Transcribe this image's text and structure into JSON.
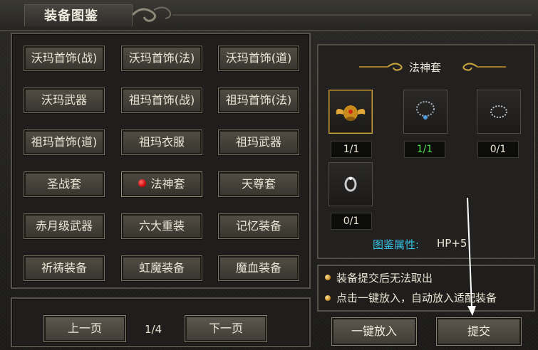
{
  "window": {
    "title": "装备图鉴"
  },
  "categories": [
    [
      "沃玛首饰(战)",
      "沃玛首饰(法)",
      "沃玛首饰(道)"
    ],
    [
      "沃玛武器",
      "祖玛首饰(战)",
      "祖玛首饰(法)"
    ],
    [
      "祖玛首饰(道)",
      "祖玛衣服",
      "祖玛武器"
    ],
    [
      "圣战套",
      "法神套",
      "天尊套"
    ],
    [
      "赤月级武器",
      "六大重装",
      "记忆装备"
    ],
    [
      "祈祷装备",
      "虹魔装备",
      "魔血装备"
    ]
  ],
  "selected_category": "法神套",
  "pager": {
    "prev_label": "上一页",
    "page": "1/4",
    "next_label": "下一页"
  },
  "set": {
    "title": "法神套",
    "items": [
      {
        "icon": "winged-helmet-icon",
        "count": "1/1",
        "collected": true
      },
      {
        "icon": "necklace-icon",
        "count": "1/1",
        "collected": true
      },
      {
        "icon": "bracelet-icon",
        "count": "0/1",
        "collected": false
      },
      {
        "icon": "ring-icon",
        "count": "0/1",
        "collected": false
      }
    ],
    "attr_label": "图鉴属性:",
    "attr_value": "HP+5"
  },
  "tips": [
    "装备提交后无法取出",
    "点击一键放入，自动放入适配装备"
  ],
  "actions": {
    "auto_fill_label": "一键放入",
    "submit_label": "提交"
  },
  "colors": {
    "accent_cyan": "#36c3e8",
    "collected_green": "#4de14d",
    "selection_gold": "#c9a33d"
  }
}
